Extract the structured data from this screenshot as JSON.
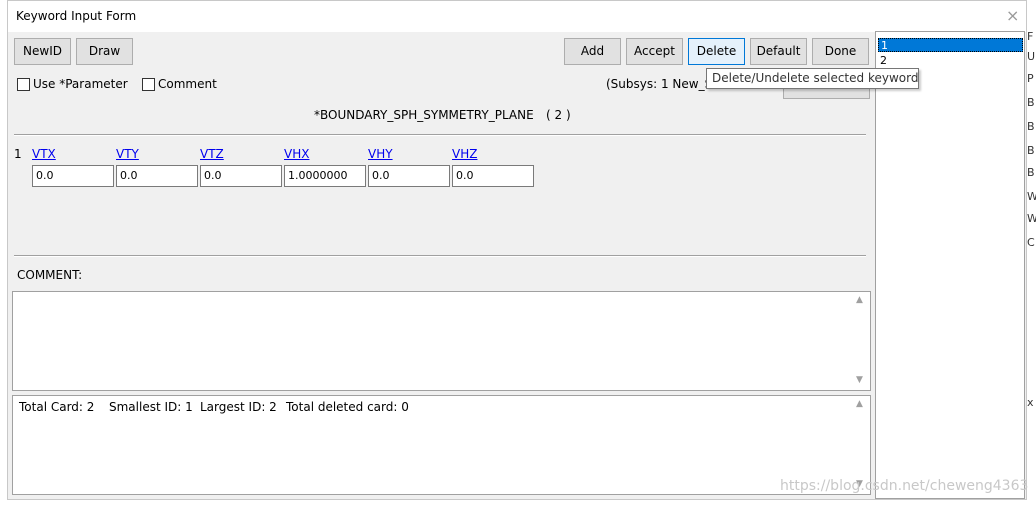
{
  "window": {
    "title": "Keyword Input Form",
    "close_glyph": "×"
  },
  "toolbar": {
    "newid": "NewID",
    "draw": "Draw",
    "add": "Add",
    "accept": "Accept",
    "delete": "Delete",
    "default": "Default",
    "done": "Done"
  },
  "options": {
    "use_parameter": "Use *Parameter",
    "comment": "Comment",
    "subsys": "(Subsys: 1 New_S"
  },
  "tooltip": "Delete/Undelete selected keyword",
  "keyword": {
    "name": "*BOUNDARY_SPH_SYMMETRY_PLANE",
    "count": "( 2 )"
  },
  "card": {
    "row_number": "1",
    "headers": [
      "VTX",
      "VTY",
      "VTZ",
      "VHX",
      "VHY",
      "VHZ"
    ],
    "values": [
      "0.0",
      "0.0",
      "0.0",
      "1.0000000",
      "0.0",
      "0.0"
    ]
  },
  "comment_label": "COMMENT:",
  "status": {
    "total_card": "Total Card: 2",
    "smallest_id": "Smallest ID: 1",
    "largest_id": "Largest ID: 2",
    "total_deleted": "Total deleted card:  0"
  },
  "id_list": [
    "1",
    "2"
  ],
  "watermark": "https://blog.csdn.net/cheweng4363",
  "colors": {
    "selection": "#0078d7",
    "link": "#0000ee",
    "window_bg": "#f0f0f0"
  }
}
